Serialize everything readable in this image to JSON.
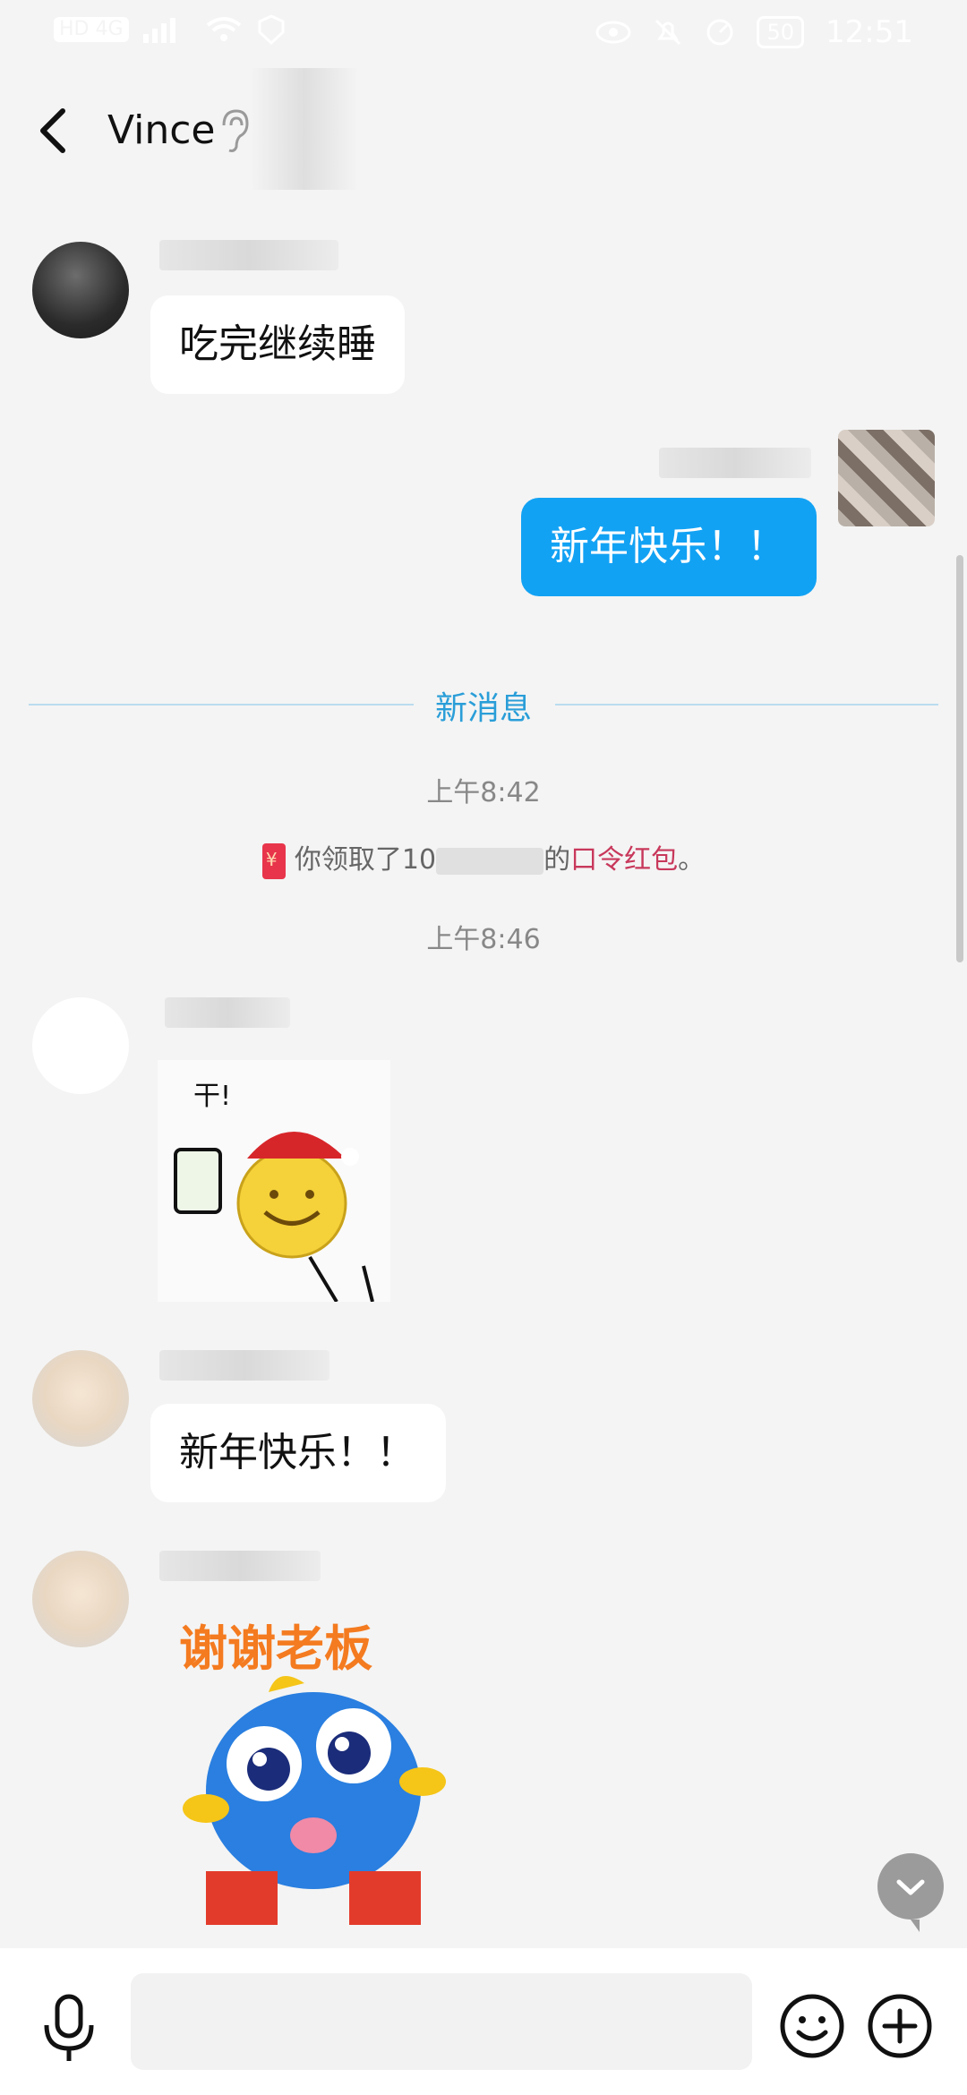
{
  "statusbar": {
    "network": "HD 4G",
    "battery": "50",
    "time": "12:51"
  },
  "header": {
    "title": "Vince",
    "back_icon": "chevron-left-icon",
    "ear_icon": "ear-icon"
  },
  "messages": [
    {
      "side": "incoming",
      "text": "吃完继续睡"
    },
    {
      "side": "outgoing",
      "text": "新年快乐！！"
    },
    {
      "side": "incoming",
      "text": "新年快乐！！"
    }
  ],
  "divider": {
    "label": "新消息"
  },
  "timestamps": {
    "first": "上午8:42",
    "second": "上午8:46"
  },
  "redpacket_notice": {
    "prefix": "你领取了10",
    "mid": "的",
    "link": "口令红包",
    "suffix": "。"
  },
  "stickers": {
    "gan": "干!",
    "thanks": "谢谢老板"
  },
  "input": {
    "placeholder": ""
  },
  "colors": {
    "accent": "#12a2f4",
    "divider": "#2a9ed8",
    "redpacket": "#c8385b"
  }
}
